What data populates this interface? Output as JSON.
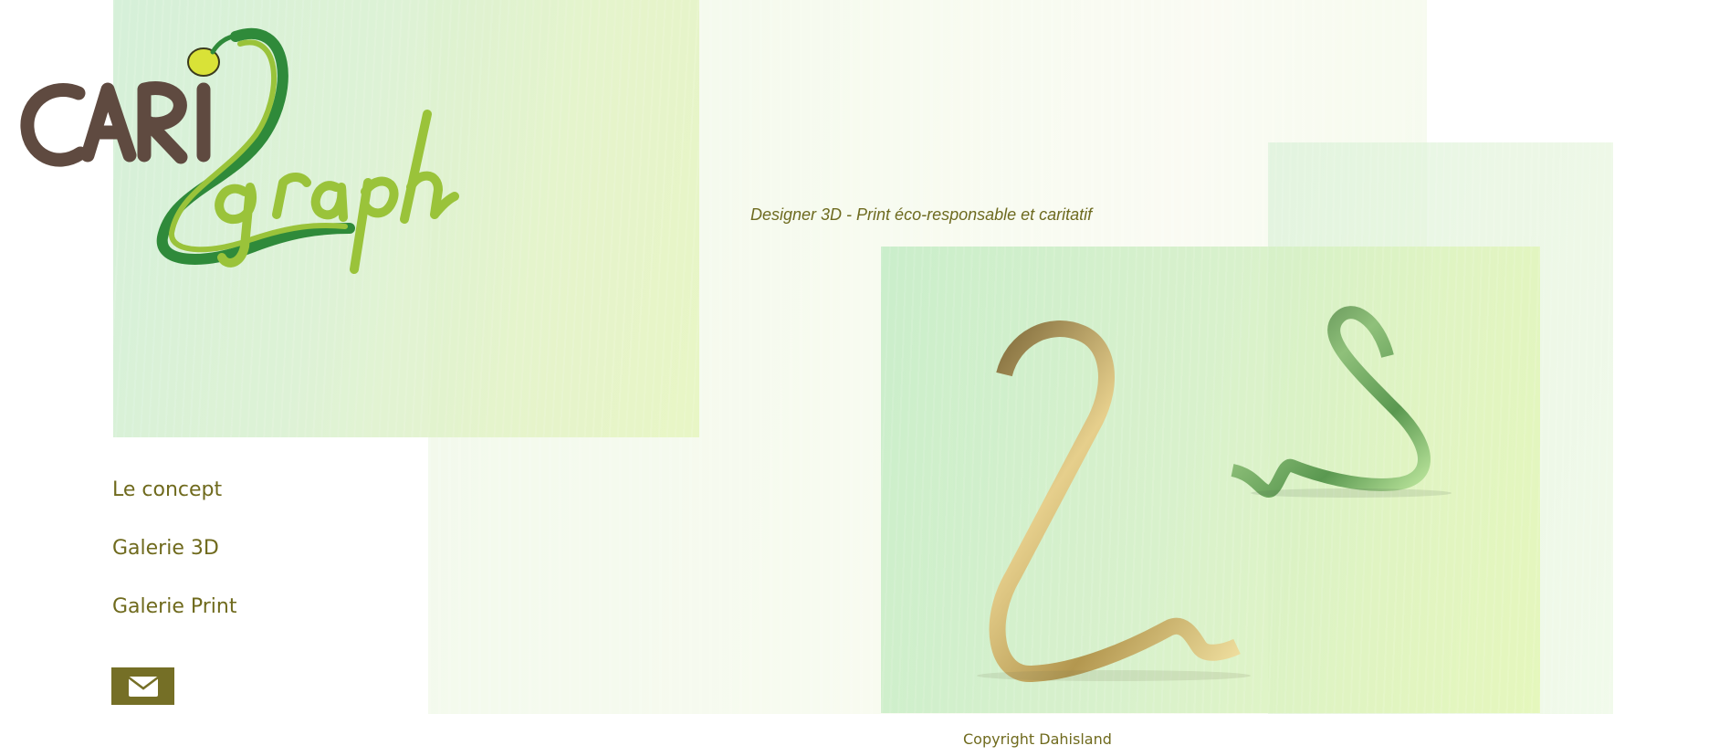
{
  "brand": {
    "logo_text": "CARI graph",
    "colors": {
      "brown": "#5f4a40",
      "green_dark": "#2f8a3a",
      "green_light": "#9ac33a",
      "yellow": "#d9e237",
      "text_olive": "#6f6a1d",
      "button_olive": "#756f26"
    }
  },
  "header": {
    "tagline": "Designer 3D - Print éco-responsable et caritatif"
  },
  "nav": {
    "items": [
      {
        "label": "Le concept"
      },
      {
        "label": "Galerie 3D"
      },
      {
        "label": "Galerie Print"
      }
    ],
    "contact_icon": "envelope-icon"
  },
  "footer": {
    "copyright": "Copyright Dahisland"
  }
}
